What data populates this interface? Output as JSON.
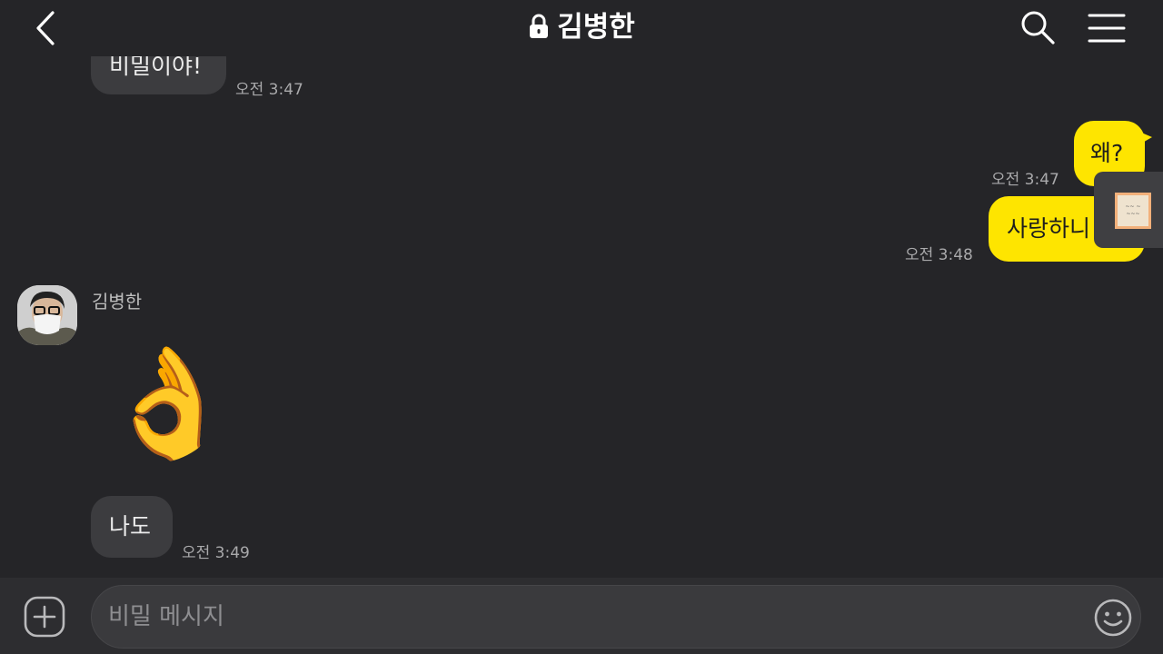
{
  "header": {
    "title": "김병한"
  },
  "contact": {
    "name": "김병한"
  },
  "messages": {
    "m1": {
      "text": "비밀이야!",
      "time": "오전 3:47"
    },
    "m2": {
      "text": "왜?",
      "time": "오전 3:47"
    },
    "m3": {
      "text": "사랑하니",
      "time": "오전 3:48"
    },
    "m4": {
      "emoji": "👌"
    },
    "m5": {
      "text": "나도",
      "time": "오전 3:49"
    }
  },
  "composer": {
    "placeholder": "비밀 메시지"
  },
  "colors": {
    "background": "#252528",
    "bubble_in": "#3c3c3f",
    "bubble_out": "#fee500",
    "text_muted": "#a9a9ab"
  },
  "icons": [
    "back-icon",
    "lock-icon",
    "search-icon",
    "menu-icon",
    "plus-icon",
    "emoji-icon"
  ]
}
